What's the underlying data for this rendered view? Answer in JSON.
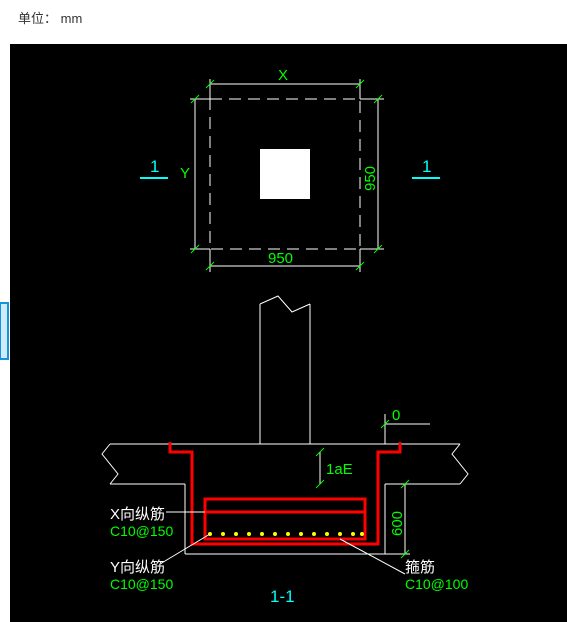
{
  "unit_prefix": "单位：",
  "unit_value": "mm",
  "plan": {
    "dim_x_label": "X",
    "dim_y_label": "Y",
    "dim_bottom": "950",
    "dim_right": "950",
    "section_mark_left": "1",
    "section_mark_right": "1"
  },
  "section": {
    "title": "1-1",
    "overhang_dim": "0",
    "anchorage_label": "1aE",
    "depth_dim": "600",
    "x_bar": {
      "label": "X向纵筋",
      "spec": "C10@150"
    },
    "y_bar": {
      "label": "Y向纵筋",
      "spec": "C10@150"
    },
    "stirrup": {
      "label": "箍筋",
      "spec": "C10@100"
    }
  },
  "colors": {
    "dim": "#00ff00",
    "rebar": "#ff0000",
    "section": "#00ffff",
    "outline": "#ffffff",
    "rebar_dot": "#ffff00"
  }
}
